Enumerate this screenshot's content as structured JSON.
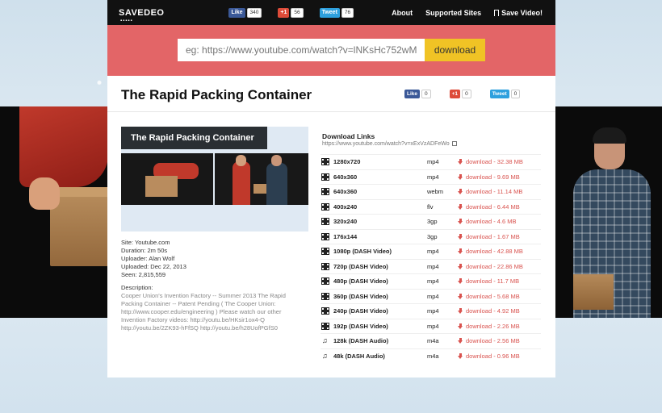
{
  "header": {
    "logo": "SAVEDEO",
    "logo_dots": "▪▪▪▪▪",
    "social": {
      "fb_label": "Like",
      "fb_count": "340",
      "gp_label": "+1",
      "gp_count": "56",
      "tw_label": "Tweet",
      "tw_count": "76"
    },
    "nav": {
      "about": "About",
      "supported": "Supported Sites",
      "save": "Save Video!"
    }
  },
  "search": {
    "placeholder": "eg: https://www.youtube.com/watch?v=lNKsHc752wM",
    "button": "download"
  },
  "video": {
    "title": "The Rapid Packing Container",
    "social": {
      "fb_label": "Like",
      "fb_count": "0",
      "gp_label": "+1",
      "gp_count": "0",
      "tw_label": "Tweet",
      "tw_count": "0"
    },
    "thumb_title": "The Rapid Packing Container",
    "meta": {
      "site": "Site: Youtube.com",
      "duration": "Duration: 2m 50s",
      "uploader": "Uploader: Alan Wolf",
      "uploaded": "Uploaded: Dec 22, 2013",
      "seen": "Seen: 2,815,559"
    },
    "description_label": "Description:",
    "description": "Cooper Union's Invention Factory -- Summer 2013 The Rapid Packing Container -- Patent Pending ( The Cooper Union: http://www.cooper.edu/engineering ) Please watch our other Invention Factory videos: http://youtu.be/HKsir1ox4-Q http://youtu.be/2ZK93-hFfSQ http://youtu.be/h28UofPGfS0"
  },
  "downloads": {
    "heading": "Download Links",
    "url": "https://www.youtube.com/watch?v=xExVzADFeWo",
    "rows": [
      {
        "icon": "film-icon",
        "quality": "1280x720",
        "format": "mp4",
        "link": "download - 32.38 MB"
      },
      {
        "icon": "film-icon",
        "quality": "640x360",
        "format": "mp4",
        "link": "download - 9.69 MB"
      },
      {
        "icon": "film-icon",
        "quality": "640x360",
        "format": "webm",
        "link": "download - 11.14 MB"
      },
      {
        "icon": "film-icon",
        "quality": "400x240",
        "format": "flv",
        "link": "download - 6.44 MB"
      },
      {
        "icon": "film-icon",
        "quality": "320x240",
        "format": "3gp",
        "link": "download - 4.6 MB"
      },
      {
        "icon": "film-icon",
        "quality": "176x144",
        "format": "3gp",
        "link": "download - 1.67 MB"
      },
      {
        "icon": "film-icon",
        "quality": "1080p (DASH Video)",
        "format": "mp4",
        "link": "download - 42.88 MB"
      },
      {
        "icon": "film-icon",
        "quality": "720p (DASH Video)",
        "format": "mp4",
        "link": "download - 22.86 MB"
      },
      {
        "icon": "film-icon",
        "quality": "480p (DASH Video)",
        "format": "mp4",
        "link": "download - 11.7 MB"
      },
      {
        "icon": "film-icon",
        "quality": "360p (DASH Video)",
        "format": "mp4",
        "link": "download - 5.68 MB"
      },
      {
        "icon": "film-icon",
        "quality": "240p (DASH Video)",
        "format": "mp4",
        "link": "download - 4.92 MB"
      },
      {
        "icon": "film-icon",
        "quality": "192p (DASH Video)",
        "format": "mp4",
        "link": "download - 2.26 MB"
      },
      {
        "icon": "music-icon",
        "quality": "128k (DASH Audio)",
        "format": "m4a",
        "link": "download - 2.56 MB"
      },
      {
        "icon": "music-icon",
        "quality": "48k (DASH Audio)",
        "format": "m4a",
        "link": "download - 0.96 MB"
      }
    ]
  },
  "colors": {
    "band": "#e36567",
    "button": "#f0c325",
    "link": "#d9534f"
  }
}
